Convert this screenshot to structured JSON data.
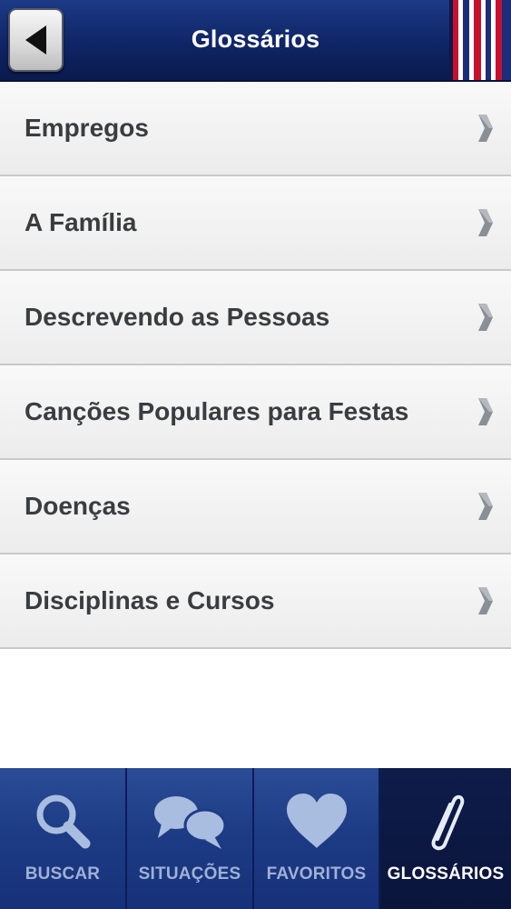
{
  "header": {
    "title": "Glossários",
    "back_icon": "back-arrow-icon",
    "flag_colors": [
      "#c8102e",
      "#ffffff",
      "#1a2f7a"
    ]
  },
  "list": {
    "items": [
      {
        "label": "Empregos"
      },
      {
        "label": "A Família"
      },
      {
        "label": "Descrevendo as Pessoas"
      },
      {
        "label": "Canções Populares para Festas"
      },
      {
        "label": "Doenças"
      },
      {
        "label": "Disciplinas e Cursos"
      }
    ],
    "chevron_icon": "chevron-right-icon"
  },
  "tabbar": {
    "tabs": [
      {
        "label": "BUSCAR",
        "icon": "search-icon",
        "active": false
      },
      {
        "label": "SITUAÇÕES",
        "icon": "speech-bubbles-icon",
        "active": false
      },
      {
        "label": "FAVORITOS",
        "icon": "heart-icon",
        "active": false
      },
      {
        "label": "GLOSSÁRIOS",
        "icon": "paperclip-icon",
        "active": true
      }
    ]
  },
  "colors": {
    "header_bg": "#0f2566",
    "tab_bg": "#1d3c85",
    "tab_active_bg": "#0a153b",
    "text_primary": "#3a3d40",
    "icon_inactive": "#a9bde0"
  }
}
